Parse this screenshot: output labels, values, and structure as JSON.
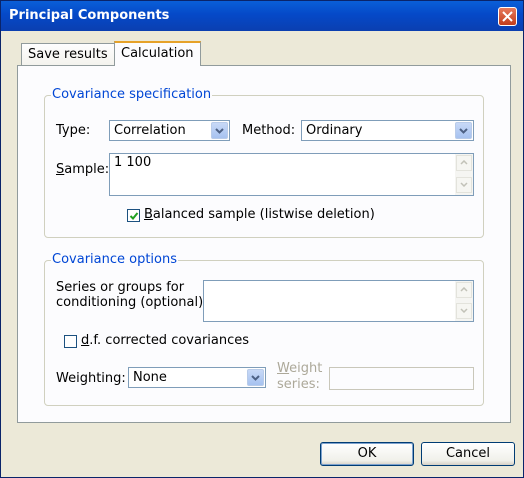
{
  "window": {
    "title": "Principal Components",
    "close_icon": "close-icon"
  },
  "tabs": [
    {
      "label": "Save results",
      "active": false
    },
    {
      "label": "Calculation",
      "active": true
    }
  ],
  "covariance_spec": {
    "legend": "Covariance specification",
    "type_label": "Type:",
    "type_value": "Correlation",
    "method_label": "Method:",
    "method_value": "Ordinary",
    "sample_label_first": "S",
    "sample_label_rest": "ample:",
    "sample_value": "1 100",
    "balanced_label_first": "B",
    "balanced_label_rest": "alanced sample (listwise deletion)",
    "balanced_checked": true
  },
  "covariance_options": {
    "legend": "Covariance options",
    "series_label_line1": "Series or groups for",
    "series_label_line2": "conditioning (optional):",
    "series_value": "",
    "df_label_first": "d",
    "df_label_rest": ".f. corrected covariances",
    "df_checked": false,
    "weighting_label": "Weighting:",
    "weighting_value": "None",
    "weight_series_label_line1_first": "W",
    "weight_series_label_line1_rest": "eight",
    "weight_series_label_line2": "series:",
    "weight_series_value": ""
  },
  "buttons": {
    "ok": "OK",
    "cancel": "Cancel"
  },
  "colors": {
    "titlebar": "#0549c8",
    "legend_text": "#0046d5",
    "tab_accent": "#e6a229"
  }
}
